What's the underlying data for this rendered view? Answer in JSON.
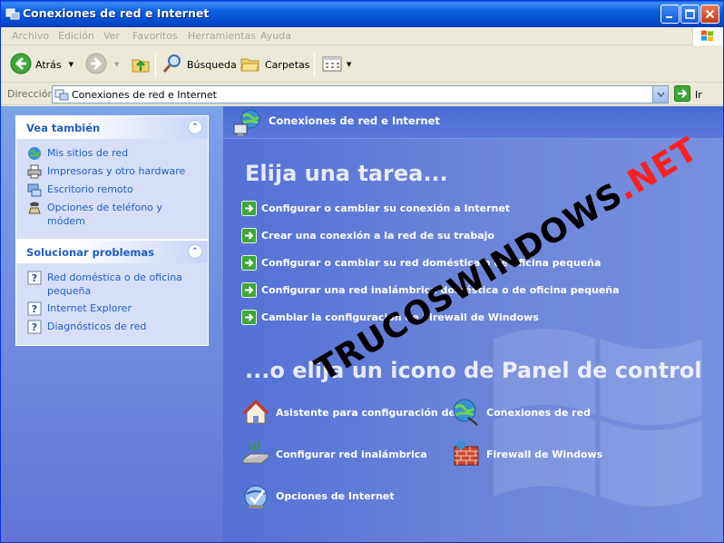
{
  "window": {
    "title": "Conexiones de red e Internet"
  },
  "menu": [
    "Archivo",
    "Edición",
    "Ver",
    "Favoritos",
    "Herramientas",
    "Ayuda"
  ],
  "toolbar": {
    "back_label": "Atrás",
    "search_label": "Búsqueda",
    "folders_label": "Carpetas"
  },
  "address": {
    "label": "Dirección",
    "value": "Conexiones de red e Internet",
    "go_label": "Ir"
  },
  "sidebar": {
    "see_also": {
      "title": "Vea también",
      "items": [
        {
          "label": "Mis sitios de red",
          "icon": "network-places-icon"
        },
        {
          "label": "Impresoras y otro hardware",
          "icon": "printer-icon"
        },
        {
          "label": "Escritorio remoto",
          "icon": "remote-desktop-icon"
        },
        {
          "label": "Opciones de teléfono y módem",
          "icon": "phone-icon"
        }
      ]
    },
    "troubleshoot": {
      "title": "Solucionar problemas",
      "items": [
        {
          "label": "Red doméstica o de oficina pequeña",
          "icon": "help-icon"
        },
        {
          "label": "Internet Explorer",
          "icon": "help-icon"
        },
        {
          "label": "Diagnósticos de red",
          "icon": "help-icon"
        }
      ]
    }
  },
  "main": {
    "header": "Conexiones de red e Internet",
    "task_heading": "Elija una tarea...",
    "tasks": [
      "Configurar o cambiar su conexión a Internet",
      "Crear una conexión a la red de su trabajo",
      "Configurar o cambiar su red doméstica o de oficina pequeña",
      "Configurar una red inalámbrica doméstica o de oficina pequeña",
      "Cambiar la configuración de Firewall de Windows"
    ],
    "icon_heading": "...o elija un icono de Panel de control",
    "icons": [
      {
        "label": "Asistente para configuración de",
        "icon": "network-setup-wizard-icon"
      },
      {
        "label": "Conexiones de red",
        "icon": "network-connections-icon"
      },
      {
        "label": "Configurar red inalámbrica",
        "icon": "wireless-network-icon"
      },
      {
        "label": "Firewall de Windows",
        "icon": "firewall-icon"
      },
      {
        "label": "Opciones de Internet",
        "icon": "internet-options-icon"
      }
    ]
  },
  "watermark": {
    "text": "TRUCOSWINDOWS",
    "suffix": ".NET"
  }
}
